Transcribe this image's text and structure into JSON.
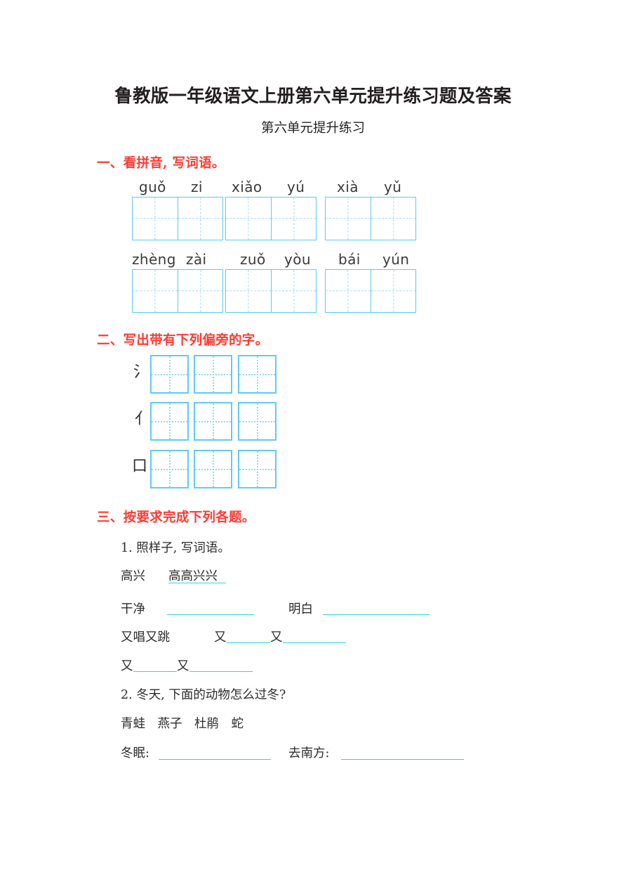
{
  "document": {
    "title": "鲁教版一年级语文上册第六单元提升练习题及答案",
    "subtitle": "第六单元提升练习"
  },
  "sections": [
    {
      "heading": "一、看拼音, 写词语。",
      "pinyin_rows": [
        {
          "items": [
            {
              "left": "guǒ",
              "right": "zi"
            },
            {
              "left": "xiǎo",
              "right": "yú"
            },
            {
              "left": "xià",
              "right": "yǔ"
            }
          ]
        },
        {
          "items": [
            {
              "left": "zhèng",
              "right": "zài"
            },
            {
              "left": "zuǒ",
              "right": "yòu"
            },
            {
              "left": "bái",
              "right": "yún"
            }
          ]
        }
      ]
    },
    {
      "heading": "二、写出带有下列偏旁的字。",
      "radicals": [
        "氵",
        "亻",
        "口"
      ],
      "boxes_per_radical": 3
    },
    {
      "heading": "三、按要求完成下列各题。",
      "items": [
        {
          "number": "1. 照样子, 写词语。",
          "example_word": "高兴",
          "example_answer": "高高兴兴",
          "prompts": [
            {
              "label": "干净"
            },
            {
              "label": "明白"
            }
          ],
          "pattern_example": "又唱又跳",
          "pattern_blank_1": "又",
          "pattern_blank_2": "又",
          "pattern_row2_a": "又",
          "pattern_row2_b": "又"
        },
        {
          "number": "2. 冬天, 下面的动物怎么过冬?",
          "animals": "青蛙　燕子　杜鹃　蛇",
          "answers": [
            {
              "label": "冬眠:"
            },
            {
              "label": "去南方:"
            }
          ]
        }
      ]
    }
  ],
  "colors": {
    "heading_red": "#fc3b32",
    "grid_blue": "#5ec8f2",
    "grid_dash_blue": "#9edcf6",
    "underline_cyan": "#25d7e8",
    "text_black": "#231f20"
  }
}
